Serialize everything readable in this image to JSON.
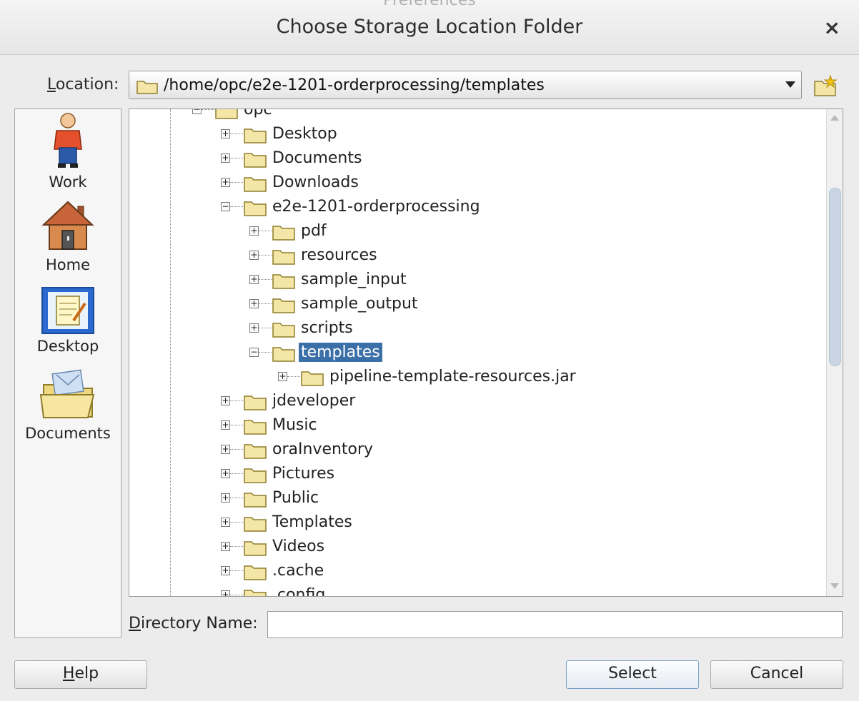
{
  "window": {
    "background_title": "Preferences",
    "title": "Choose Storage Location Folder",
    "close_symbol": "×"
  },
  "location": {
    "label_mnemonic": "L",
    "label_rest": "ocation:",
    "path": "/home/opc/e2e-1201-orderprocessing/templates",
    "new_folder_icon": "new-folder-icon"
  },
  "places": [
    {
      "label": "Work",
      "icon": "work-person-icon"
    },
    {
      "label": "Home",
      "icon": "home-house-icon"
    },
    {
      "label": "Desktop",
      "icon": "desktop-notepad-icon"
    },
    {
      "label": "Documents",
      "icon": "documents-folder-icon"
    }
  ],
  "tree": {
    "selected": "templates",
    "nodes": [
      {
        "label": "opc",
        "level": 0,
        "state": "expanded"
      },
      {
        "label": "Desktop",
        "level": 1,
        "state": "collapsed"
      },
      {
        "label": "Documents",
        "level": 1,
        "state": "collapsed"
      },
      {
        "label": "Downloads",
        "level": 1,
        "state": "collapsed"
      },
      {
        "label": "e2e-1201-orderprocessing",
        "level": 1,
        "state": "expanded"
      },
      {
        "label": "pdf",
        "level": 2,
        "state": "collapsed"
      },
      {
        "label": "resources",
        "level": 2,
        "state": "collapsed"
      },
      {
        "label": "sample_input",
        "level": 2,
        "state": "collapsed"
      },
      {
        "label": "sample_output",
        "level": 2,
        "state": "collapsed"
      },
      {
        "label": "scripts",
        "level": 2,
        "state": "collapsed"
      },
      {
        "label": "templates",
        "level": 2,
        "state": "expanded"
      },
      {
        "label": "pipeline-template-resources.jar",
        "level": 3,
        "state": "collapsed"
      },
      {
        "label": "jdeveloper",
        "level": 1,
        "state": "collapsed"
      },
      {
        "label": "Music",
        "level": 1,
        "state": "collapsed"
      },
      {
        "label": "oraInventory",
        "level": 1,
        "state": "collapsed"
      },
      {
        "label": "Pictures",
        "level": 1,
        "state": "collapsed"
      },
      {
        "label": "Public",
        "level": 1,
        "state": "collapsed"
      },
      {
        "label": "Templates",
        "level": 1,
        "state": "collapsed"
      },
      {
        "label": "Videos",
        "level": 1,
        "state": "collapsed"
      },
      {
        "label": ".cache",
        "level": 1,
        "state": "collapsed"
      },
      {
        "label": ".config",
        "level": 1,
        "state": "collapsed"
      }
    ]
  },
  "directory_name": {
    "label_mnemonic": "D",
    "label_rest": "irectory Name:",
    "value": ""
  },
  "buttons": {
    "help_mnemonic": "H",
    "help_rest": "elp",
    "select": "Select",
    "cancel": "Cancel"
  },
  "colors": {
    "selection": "#3b6fa8",
    "folder_fill": "#f3e6a6",
    "folder_stroke": "#8f7d2c"
  }
}
